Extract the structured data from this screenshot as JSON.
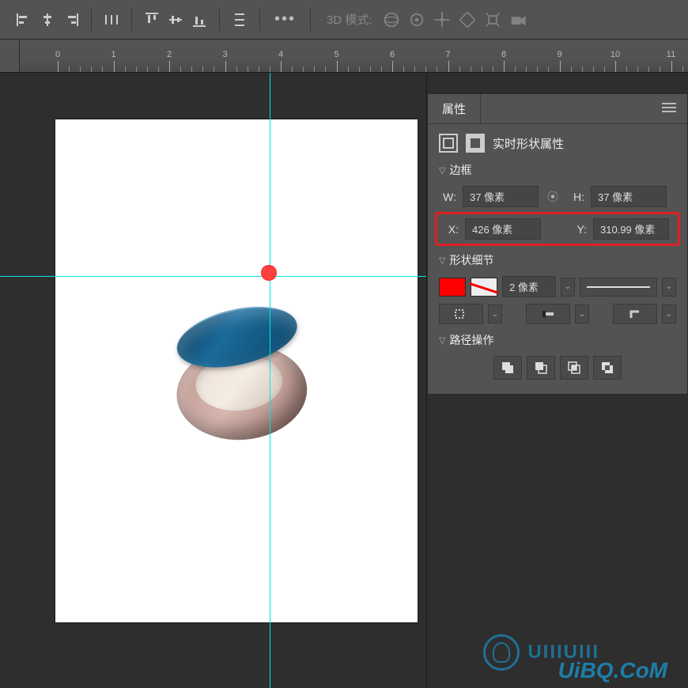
{
  "toolbar": {
    "td_mode_label": "3D 模式:"
  },
  "ruler": {
    "majors": [
      0,
      1,
      2,
      3,
      4,
      5,
      6,
      7,
      8,
      9,
      10,
      11
    ]
  },
  "panel": {
    "tab_label": "属性",
    "subtype_label": "实时形状属性",
    "section_bounds": "边框",
    "w_label": "W:",
    "h_label": "H:",
    "w_value": "37 像素",
    "h_value": "37 像素",
    "x_label": "X:",
    "y_label": "Y:",
    "x_value": "426 像素",
    "y_value": "310.99 像素",
    "section_detail": "形状细节",
    "stroke_width_value": "2 像素",
    "section_pathops": "路径操作"
  },
  "watermark": {
    "brand": "UIIIUIII",
    "site": "UiBQ.CoM"
  }
}
